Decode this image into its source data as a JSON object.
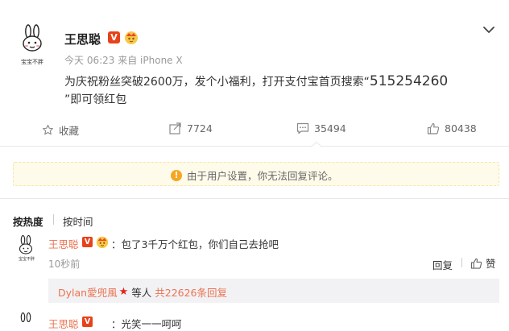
{
  "post": {
    "author": "王思聪",
    "verified_badge": "V",
    "time": "今天 06:23",
    "source": "来自 iPhone X",
    "avatar_caption": "宝宝不胖",
    "text_line1": "为庆祝粉丝突破2600万，发个小福利，打开支付宝首页搜索“",
    "code": "515254260",
    "text_line2": "”即可领红包"
  },
  "actions": {
    "favorite": "收藏",
    "repost": "7724",
    "comment": "35494",
    "like": "80438"
  },
  "notice": {
    "text": "由于用户设置，你无法回复评论。"
  },
  "sort": {
    "hot": "按热度",
    "time": "按时间"
  },
  "comment": {
    "author": "王思聪",
    "badge": "V",
    "text": "：包了3千万个红包，你们自己去抢吧",
    "time": "10秒前",
    "reply": "回复",
    "like": "赞",
    "avatar_caption": "宝宝不胖",
    "sub": {
      "name": "Dylan愛兜風",
      "suffix": "等人",
      "count": "共22626条回复"
    }
  },
  "cut_comment": {
    "author": "王思聪",
    "text": "：光笑一一呵呵"
  },
  "colors": {
    "accent": "#eb7350",
    "badge": "#e7421b",
    "notice_bg": "#fffbea"
  }
}
